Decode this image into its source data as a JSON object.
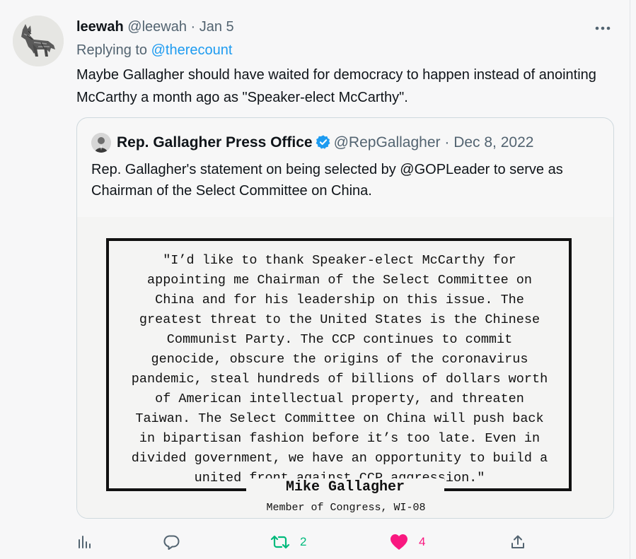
{
  "tweet": {
    "display_name": "leewah",
    "handle": "@leewah",
    "separator": "·",
    "date": "Jan 5",
    "replying_prefix": "Replying to",
    "replying_to": "@therecount",
    "text": "Maybe Gallagher should have waited for democracy to happen instead of anointing McCarthy a month ago as \"Speaker-elect McCarthy\".",
    "more_icon": "more-horizontal-icon"
  },
  "quoted": {
    "display_name": "Rep. Gallagher Press Office",
    "verified_icon": "verified-badge-icon",
    "handle": "@RepGallagher",
    "separator": "·",
    "date": "Dec 8, 2022",
    "text": "Rep. Gallagher's statement on being selected by @GOPLeader to serve as Chairman of the Select Committee on China.",
    "image": {
      "lines": [
        "\"I’d like to thank Speaker-elect McCarthy for",
        "appointing me Chairman of the Select Committee on",
        "China and for his leadership on this issue. The",
        "greatest threat to the United States is the Chinese",
        "Communist Party. The CCP continues to commit",
        "genocide, obscure the origins of the coronavirus",
        "pandemic, steal hundreds of billions of dollars worth",
        "of American intellectual property, and threaten",
        "Taiwan. The Select Committee on China will push back",
        "in bipartisan fashion before it’s too late. Even in",
        "divided government, we have an opportunity to build a",
        "united front against CCP aggression.\""
      ],
      "signature_name": "Mike Gallagher",
      "signature_title": "Member of Congress, WI-08"
    }
  },
  "actions": {
    "analytics_icon": "analytics-icon",
    "reply_icon": "reply-icon",
    "retweet_icon": "retweet-icon",
    "retweet_count": "2",
    "like_icon": "like-heart-icon",
    "like_count": "4",
    "share_icon": "share-icon",
    "retweet_color": "#00ba7c",
    "like_color": "#f91880"
  },
  "colors": {
    "link": "#1d9bf0",
    "muted": "#536471",
    "verified": "#1d9bf0"
  }
}
